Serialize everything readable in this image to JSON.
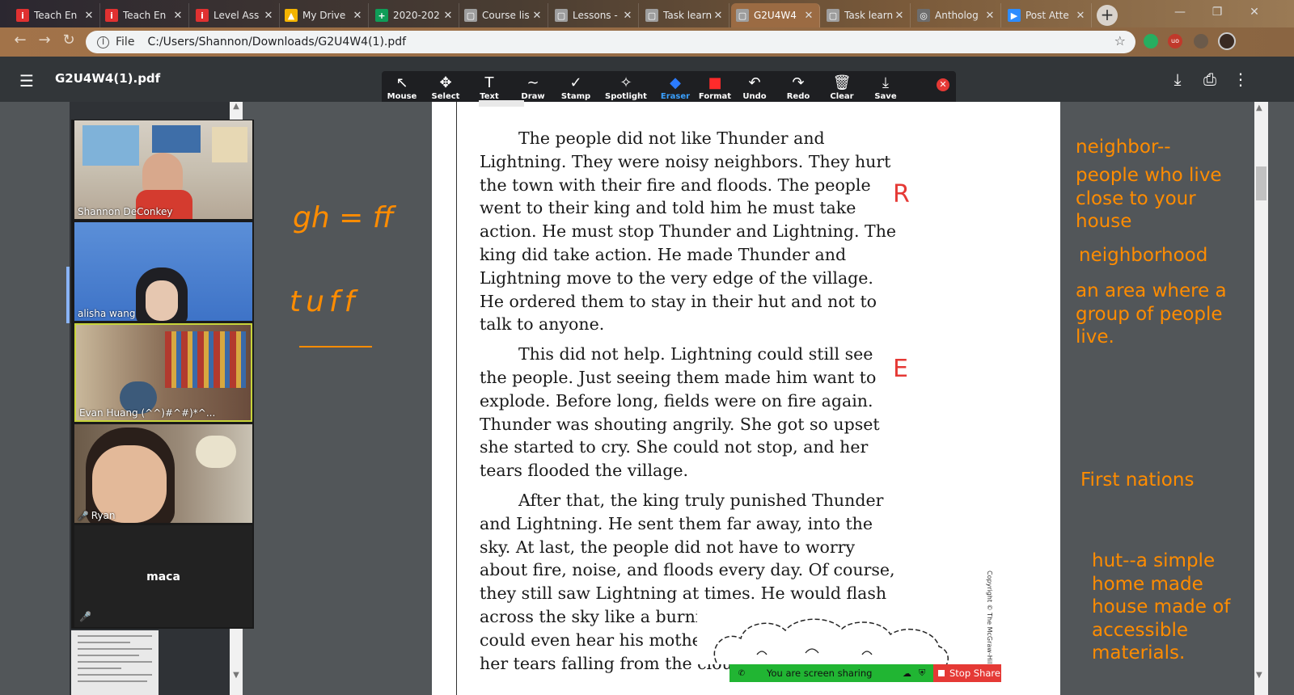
{
  "browser": {
    "tabs": [
      {
        "label": "Teach En",
        "color": "#e03131",
        "glyph": "i"
      },
      {
        "label": "Teach En",
        "color": "#e03131",
        "glyph": "i"
      },
      {
        "label": "Level Ass",
        "color": "#e03131",
        "glyph": "i"
      },
      {
        "label": "My Drive",
        "color": "#f4b400",
        "glyph": "▲"
      },
      {
        "label": "2020-202",
        "color": "#0f9d58",
        "glyph": "+"
      },
      {
        "label": "Course lis",
        "color": "#9e9e9e",
        "glyph": "▢"
      },
      {
        "label": "Lessons -",
        "color": "#9e9e9e",
        "glyph": "▢"
      },
      {
        "label": "Task learn",
        "color": "#9e9e9e",
        "glyph": "▢"
      },
      {
        "label": "G2U4W4",
        "color": "#9e9e9e",
        "glyph": "▢"
      },
      {
        "label": "Task learn",
        "color": "#9e9e9e",
        "glyph": "▢"
      },
      {
        "label": "Antholog",
        "color": "#6d6d6d",
        "glyph": "◎"
      },
      {
        "label": "Post Atte",
        "color": "#2d8cff",
        "glyph": "▶"
      }
    ],
    "active_tab": 8,
    "new_tab": "+",
    "address": {
      "scheme": "File",
      "url": "C:/Users/Shannon/Downloads/G2U4W4(1).pdf"
    }
  },
  "pdf": {
    "title": "G2U4W4(1).pdf",
    "paragraphs": [
      "The people did not like Thunder and Lightning. They were noisy neighbors. They hurt the town with their fire and floods. The people went to their king and told him he must take action. He must stop Thunder and Lightning. The king did take action. He made Thunder and Lightning move to the very edge of the village. He ordered them to stay in their hut and not to talk to anyone.",
      "This did not help. Lightning could still see the people. Just seeing them made him want to explode. Before long, fields were on fire again. Thunder was shouting angrily. She got so upset she started to cry. She could not stop, and her tears flooded the village.",
      "After that, the king truly punished Thunder and Lightning. He sent them far away, into the sky. At last, the people did not have to worry about fire, noise, and floods every day. Of course, they still saw Lightning at times. He would flash across the sky like a burning arrow. The people could even hear his mother yelling at him and see her tears falling from the clouds."
    ],
    "copyright": "Copyright © The McGraw-Hill Com"
  },
  "annotate_toolbar": {
    "tools": [
      {
        "label": "Mouse",
        "icon": "↖"
      },
      {
        "label": "Select",
        "icon": "✥"
      },
      {
        "label": "Text",
        "icon": "T"
      },
      {
        "label": "Draw",
        "icon": "∼"
      },
      {
        "label": "Stamp",
        "icon": "✓"
      },
      {
        "label": "Spotlight",
        "icon": "✧"
      },
      {
        "label": "Eraser",
        "icon": "◆"
      },
      {
        "label": "Format",
        "icon": "■"
      },
      {
        "label": "Undo",
        "icon": "↶"
      },
      {
        "label": "Redo",
        "icon": "↷"
      },
      {
        "label": "Clear",
        "icon": "🗑"
      },
      {
        "label": "Save",
        "icon": "⤓"
      }
    ],
    "close": "✕"
  },
  "participants": [
    {
      "name": "Shannon DeConkey"
    },
    {
      "name": "alisha wang"
    },
    {
      "name": "Evan Huang (^^)#^#)*^..."
    },
    {
      "name": "Ryan"
    },
    {
      "name": "maca"
    }
  ],
  "annotations": {
    "left": [
      "gh = ff",
      "tuff"
    ],
    "margin": [
      "R",
      "E"
    ],
    "notes": [
      "neighbor--",
      "people who live close to your house",
      "neighborhood",
      "an area where a group of people live.",
      "First nations",
      "hut--a simple home made house made of accessible materials."
    ]
  },
  "sharing": {
    "status": "You are screen sharing",
    "stop": "Stop Share"
  },
  "colors": {
    "annotation": "#ff8c00",
    "margin_mark": "#e53935",
    "share_green": "#21b533",
    "stop_red": "#e53935"
  }
}
